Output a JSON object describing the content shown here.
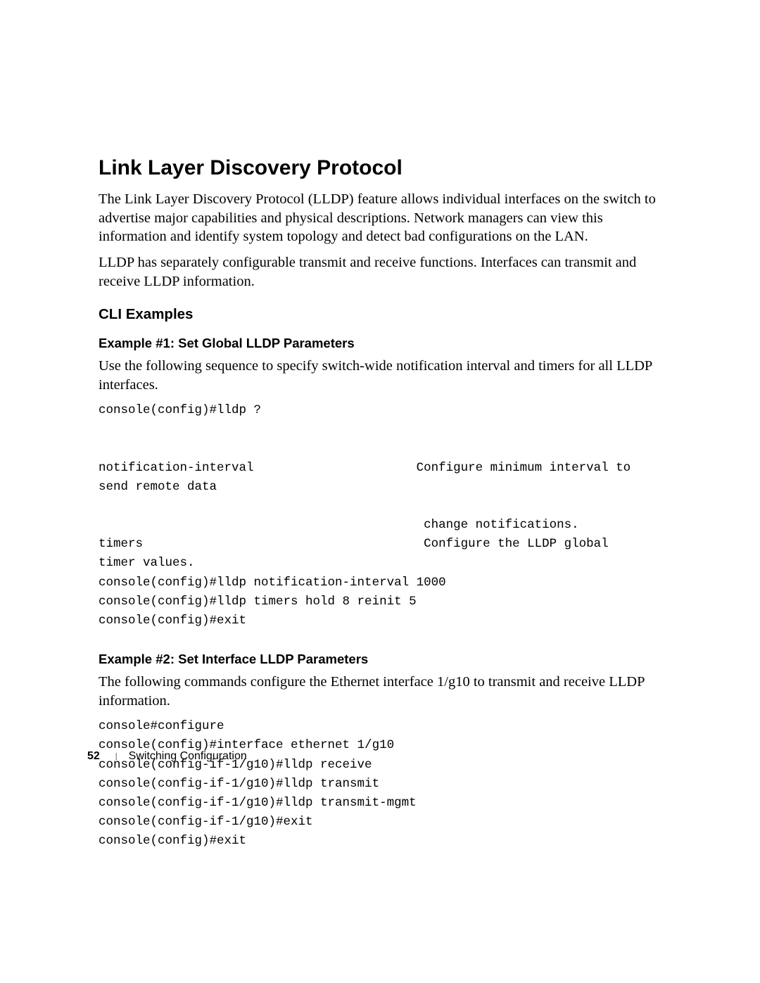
{
  "heading": "Link Layer Discovery Protocol",
  "intro1": "The Link Layer Discovery Protocol (LLDP) feature allows individual interfaces on the switch to advertise major capabilities and physical descriptions. Network managers can view this information and identify system topology and detect bad configurations on the LAN.",
  "intro2": "LLDP has separately configurable transmit and receive functions. Interfaces can transmit and receive LLDP information.",
  "cli_examples_heading": "CLI Examples",
  "ex1": {
    "title": "Example #1: Set Global LLDP Parameters",
    "desc": "Use the following sequence to specify switch-wide notification interval and timers for all LLDP interfaces.",
    "code": "console(config)#lldp ?\n\n\nnotification-interval                      Configure minimum interval to\nsend remote data\n\n                                            change notifications.\ntimers                                      Configure the LLDP global\ntimer values.\nconsole(config)#lldp notification-interval 1000\nconsole(config)#lldp timers hold 8 reinit 5\nconsole(config)#exit"
  },
  "ex2": {
    "title": "Example #2: Set Interface LLDP Parameters",
    "desc": "The following commands configure the Ethernet interface 1/g10 to transmit and receive LLDP information.",
    "code": "console#configure\nconsole(config)#interface ethernet 1/g10\nconsole(config-if-1/g10)#lldp receive\nconsole(config-if-1/g10)#lldp transmit\nconsole(config-if-1/g10)#lldp transmit-mgmt\nconsole(config-if-1/g10)#exit\nconsole(config)#exit"
  },
  "footer": {
    "page": "52",
    "chapter": "Switching Configuration"
  }
}
